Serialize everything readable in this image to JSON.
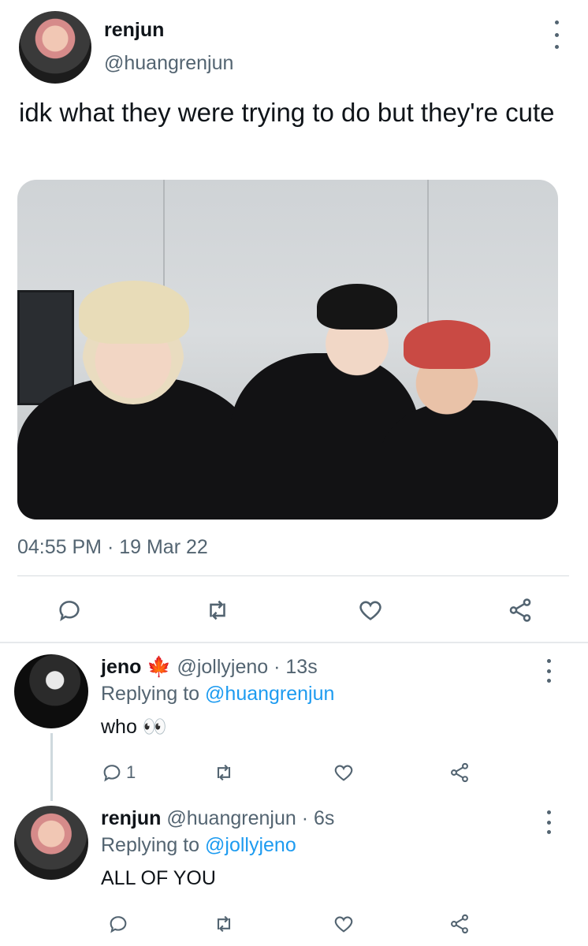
{
  "main_tweet": {
    "author_name": "renjun",
    "author_handle": "@huangrenjun",
    "text": "idk what they were trying to do but they're cute",
    "timestamp": "04:55 PM · 19 Mar 22",
    "actions": [
      "reply-icon",
      "retweet-icon",
      "like-icon",
      "share-icon"
    ]
  },
  "replies": [
    {
      "name": "jeno",
      "emoji": "🍁",
      "handle": "@jollyjeno",
      "time": "· 13s",
      "replying_prefix": "Replying to",
      "replying_to": "@huangrenjun",
      "text": "who 👀",
      "reply_count": "1"
    },
    {
      "name": "renjun",
      "handle": "@huangrenjun",
      "time": "· 6s",
      "replying_prefix": "Replying to",
      "replying_to": "@jollyjeno",
      "text": "ALL OF YOU",
      "reply_count": ""
    }
  ],
  "colors": {
    "text": "#0f1419",
    "muted": "#536471",
    "link": "#1d9bf0",
    "divider": "#d7dbdf"
  }
}
